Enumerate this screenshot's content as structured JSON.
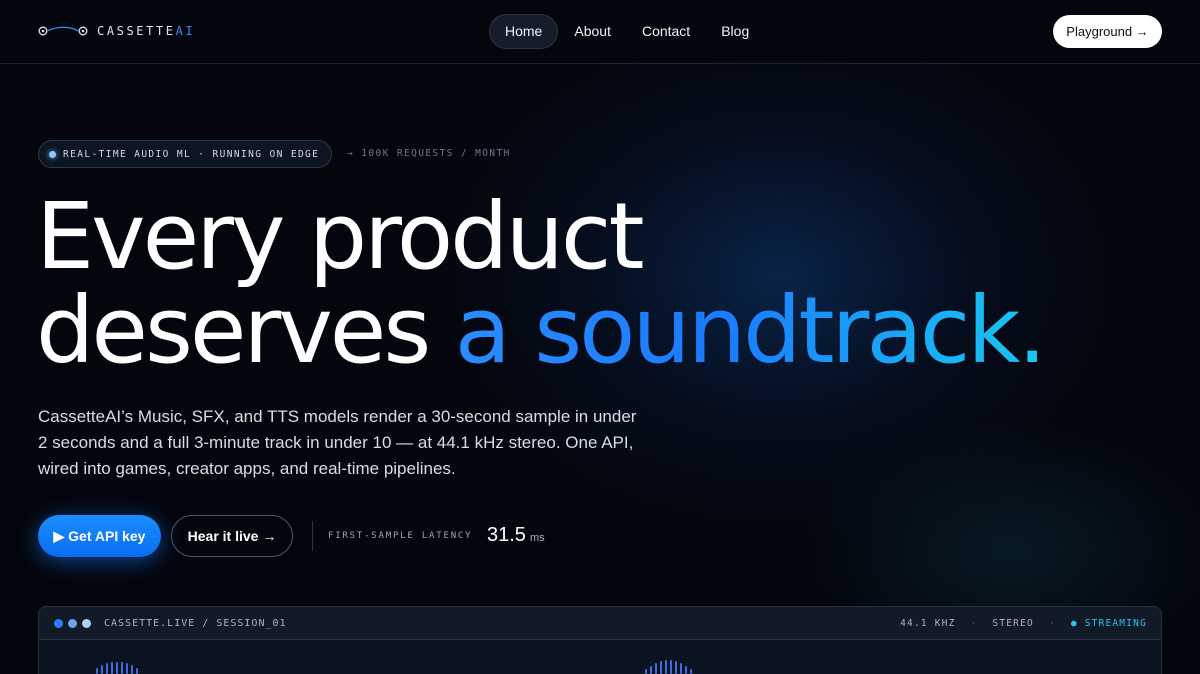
{
  "nav": {
    "logo_text": "CASSETTE",
    "logo_accent": "AI",
    "items": [
      {
        "label": "Home",
        "active": true
      },
      {
        "label": "About",
        "active": false
      },
      {
        "label": "Contact",
        "active": false
      },
      {
        "label": "Blog",
        "active": false
      }
    ],
    "cta_label": "Playground →"
  },
  "badge": {
    "text": "REAL-TIME AUDIO ML · RUNNING ON EDGE",
    "side_text": "→ 100K REQUESTS / MONTH"
  },
  "hero": {
    "line1": "Every product",
    "line2_plain": "deserves ",
    "line2_accent": "a soundtrack.",
    "subtitle": "CassetteAI’s Music, SFX, and TTS models render a 30-second sample in under 2 seconds and a full 3-minute track in under 10 — at 44.1 kHz stereo. One API, wired into games, creator apps, and real-time pipelines."
  },
  "cta": {
    "primary_label": "▶ Get API key",
    "secondary_label": "Hear it live →",
    "latency_label": "FIRST-SAMPLE LATENCY",
    "latency_value": "31.5",
    "latency_unit": "ms"
  },
  "panel": {
    "title": "CASSETTE.LIVE / SESSION_01",
    "sample_rate": "44.1 KHZ",
    "separator": "·",
    "channels": "STEREO",
    "status": "● STREAMING"
  },
  "colors": {
    "background": "#04060d",
    "accent": "#1a7bff",
    "accent_cyan": "#19c9f0",
    "dot_1": "#2b7fff",
    "dot_2": "#6aa6f0",
    "dot_3": "#a8d2f5"
  },
  "icons": {
    "logo_mark": "cassette-reels-icon",
    "badge_dot": "status-dot-icon"
  }
}
